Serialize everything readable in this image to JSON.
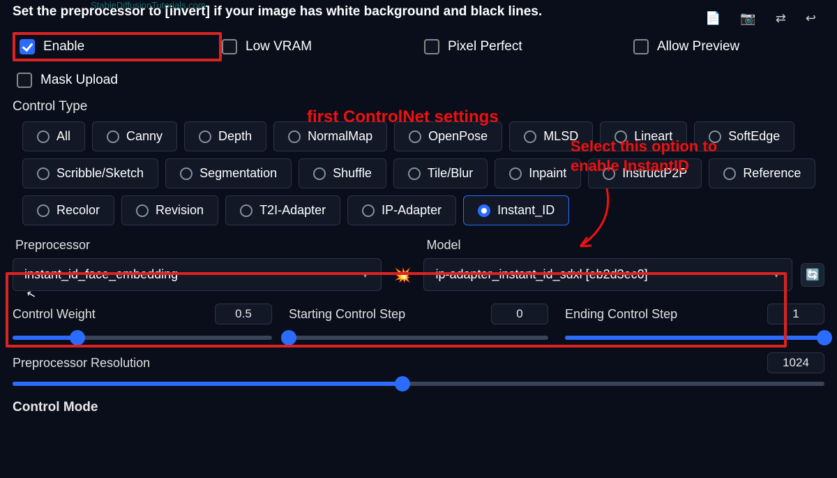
{
  "watermark": "StableDiffusionTutorials.com",
  "hint": "Set the preprocessor to [invert] if your image has white background and black lines.",
  "checkboxes": {
    "enable": "Enable",
    "low_vram": "Low VRAM",
    "pixel_perfect": "Pixel Perfect",
    "allow_preview": "Allow Preview",
    "mask_upload": "Mask Upload"
  },
  "control_type": {
    "label": "Control Type",
    "options": [
      "All",
      "Canny",
      "Depth",
      "NormalMap",
      "OpenPose",
      "MLSD",
      "Lineart",
      "SoftEdge",
      "Scribble/Sketch",
      "Segmentation",
      "Shuffle",
      "Tile/Blur",
      "Inpaint",
      "InstructP2P",
      "Reference",
      "Recolor",
      "Revision",
      "T2I-Adapter",
      "IP-Adapter",
      "Instant_ID"
    ],
    "selected": "Instant_ID"
  },
  "preprocessor": {
    "label": "Preprocessor",
    "value": "instant_id_face_embedding"
  },
  "model": {
    "label": "Model",
    "value": "ip-adapter_instant_id_sdxl [eb2d3ec0]"
  },
  "sliders": {
    "control_weight": {
      "label": "Control Weight",
      "value": "0.5",
      "percent": 25
    },
    "start_step": {
      "label": "Starting Control Step",
      "value": "0",
      "percent": 0
    },
    "end_step": {
      "label": "Ending Control Step",
      "value": "1",
      "percent": 100
    },
    "pre_res": {
      "label": "Preprocessor Resolution",
      "value": "1024",
      "percent": 48
    }
  },
  "control_mode_label": "Control Mode",
  "annotations": {
    "title": "first ControlNet settings",
    "note": "Select this option to enable InstantID"
  }
}
